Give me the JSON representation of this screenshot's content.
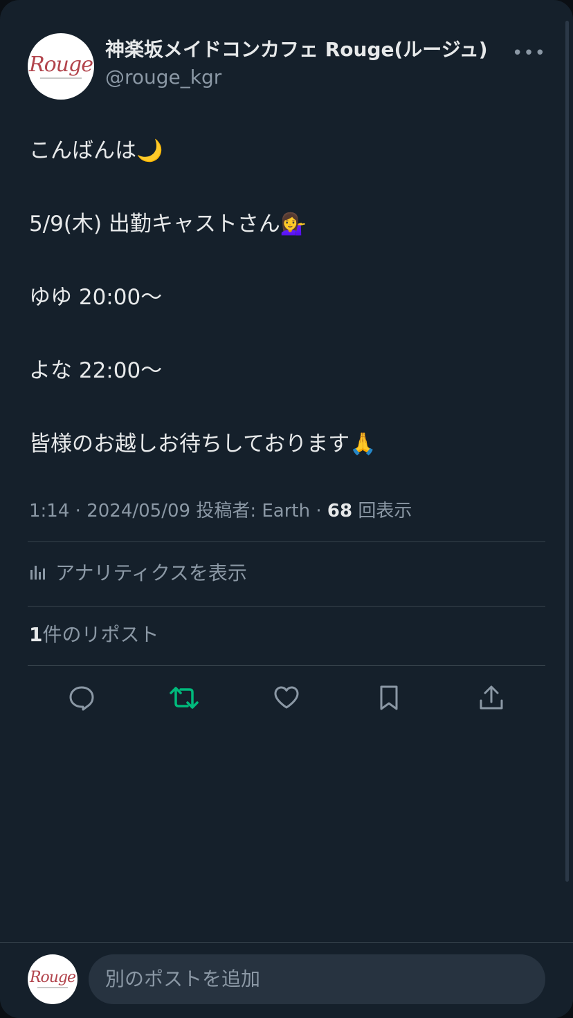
{
  "author": {
    "display_name": "神楽坂メイドコンカフェ Rouge(ルージュ)",
    "handle": "@rouge_kgr",
    "avatar_logo_text": "Rouge"
  },
  "more_label": "•••",
  "tweet": {
    "lines": [
      "こんばんは🌙",
      "5/9(木) 出勤キャストさん💁‍♀️",
      "ゆゆ 20:00～",
      "よな 22:00～",
      "皆様のお越しお待ちしております🙏"
    ]
  },
  "meta": {
    "time": "1:14",
    "date": "2024/05/09",
    "posted_by_label": "投稿者:",
    "posted_by": "Earth",
    "view_count": "68",
    "view_label": "回表示"
  },
  "analytics_label": "アナリティクスを表示",
  "reposts": {
    "count": "1",
    "label": "件のリポスト"
  },
  "actions": {
    "reply_icon": "reply-icon",
    "repost_icon": "repost-icon",
    "like_icon": "heart-icon",
    "bookmark_icon": "bookmark-icon",
    "share_icon": "share-icon",
    "repost_active_color": "#00ba7c",
    "icon_color": "#8b98a5"
  },
  "reply_bar": {
    "avatar_logo_text": "Rouge",
    "placeholder": "別のポストを追加"
  },
  "colors": {
    "background": "#15202b",
    "text": "#e7e9ea",
    "secondary": "#8b98a5",
    "divider": "#38444d"
  }
}
